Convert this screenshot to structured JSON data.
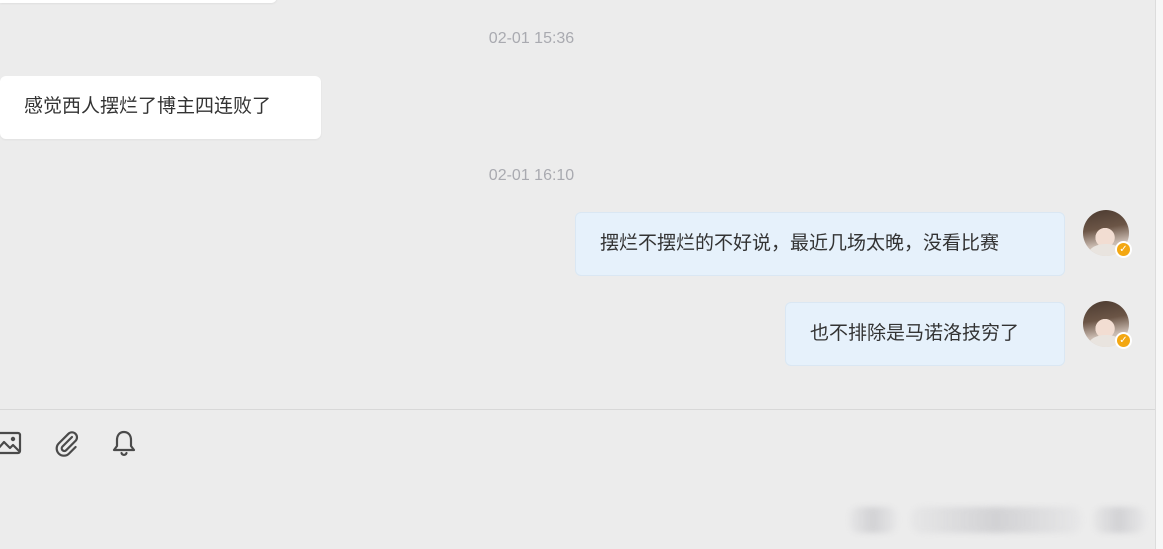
{
  "conversation": {
    "messages": [
      {
        "type": "timestamp",
        "text": "02-01 15:36"
      },
      {
        "type": "message",
        "direction": "incoming",
        "text": "感觉西人摆烂了博主四连败了"
      },
      {
        "type": "timestamp",
        "text": "02-01 16:10"
      },
      {
        "type": "message",
        "direction": "outgoing",
        "text": "摆烂不摆烂的不好说，最近几场太晚，没看比赛"
      },
      {
        "type": "message",
        "direction": "outgoing",
        "text": "也不排除是马诺洛技穷了"
      }
    ]
  },
  "avatar": {
    "badge_glyph": "✓",
    "badge_color": "#f3a712"
  },
  "composer": {
    "toolbar": [
      {
        "icon": "image-icon"
      },
      {
        "icon": "paperclip-icon"
      },
      {
        "icon": "bell-icon"
      }
    ]
  },
  "colors": {
    "background": "#ececec",
    "incoming_bubble": "#ffffff",
    "outgoing_bubble": "#e6f1fb",
    "timestamp_text": "#a9aab0",
    "message_text": "#333333"
  }
}
